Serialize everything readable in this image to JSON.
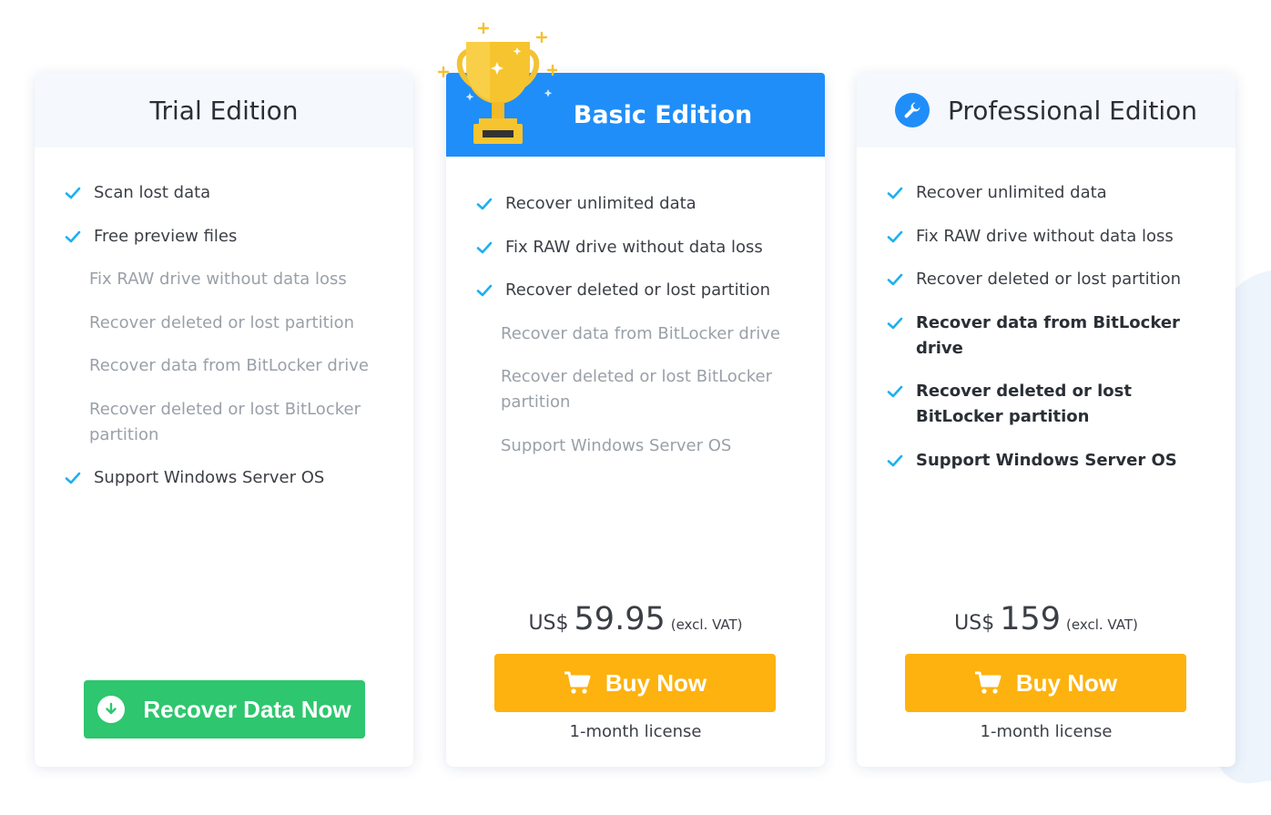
{
  "colors": {
    "accent_blue": "#1f8ef9",
    "buy_orange": "#fdb20f",
    "recover_green": "#2ec66e",
    "check_color": "#1fb0f0"
  },
  "trial": {
    "title": "Trial Edition",
    "features": [
      {
        "text": "Scan lost data",
        "state": "check"
      },
      {
        "text": "Free preview files",
        "state": "check"
      },
      {
        "text": "Fix RAW drive without data loss",
        "state": "off"
      },
      {
        "text": "Recover deleted or lost partition",
        "state": "off"
      },
      {
        "text": "Recover data from BitLocker drive",
        "state": "off"
      },
      {
        "text": "Recover deleted or lost BitLocker partition",
        "state": "off"
      },
      {
        "text": "Support Windows Server OS",
        "state": "check"
      }
    ],
    "button_label": "Recover Data Now",
    "button_icon": "download-circle-icon"
  },
  "basic": {
    "title": "Basic Edition",
    "icon": "trophy-icon",
    "features": [
      {
        "text": "Recover unlimited data",
        "state": "check"
      },
      {
        "text": "Fix RAW drive without data loss",
        "state": "check"
      },
      {
        "text": "Recover deleted or lost partition",
        "state": "check"
      },
      {
        "text": "Recover data from BitLocker drive",
        "state": "off"
      },
      {
        "text": "Recover deleted or lost BitLocker partition",
        "state": "off"
      },
      {
        "text": "Support Windows Server OS",
        "state": "off"
      }
    ],
    "price_currency": "US$",
    "price_amount": "59.95",
    "price_note": "(excl. VAT)",
    "button_label": "Buy Now",
    "button_icon": "cart-icon",
    "license": "1-month license"
  },
  "pro": {
    "title": "Professional Edition",
    "icon": "wrench-icon",
    "features": [
      {
        "text": "Recover unlimited data",
        "state": "check"
      },
      {
        "text": "Fix RAW drive without data loss",
        "state": "check"
      },
      {
        "text": "Recover deleted or lost partition",
        "state": "check"
      },
      {
        "text": "Recover data from BitLocker drive",
        "state": "bold"
      },
      {
        "text": "Recover deleted or lost BitLocker partition",
        "state": "bold"
      },
      {
        "text": "Support Windows Server OS",
        "state": "bold"
      }
    ],
    "price_currency": "US$",
    "price_amount": "159",
    "price_note": "(excl. VAT)",
    "button_label": "Buy Now",
    "button_icon": "cart-icon",
    "license": "1-month license"
  }
}
